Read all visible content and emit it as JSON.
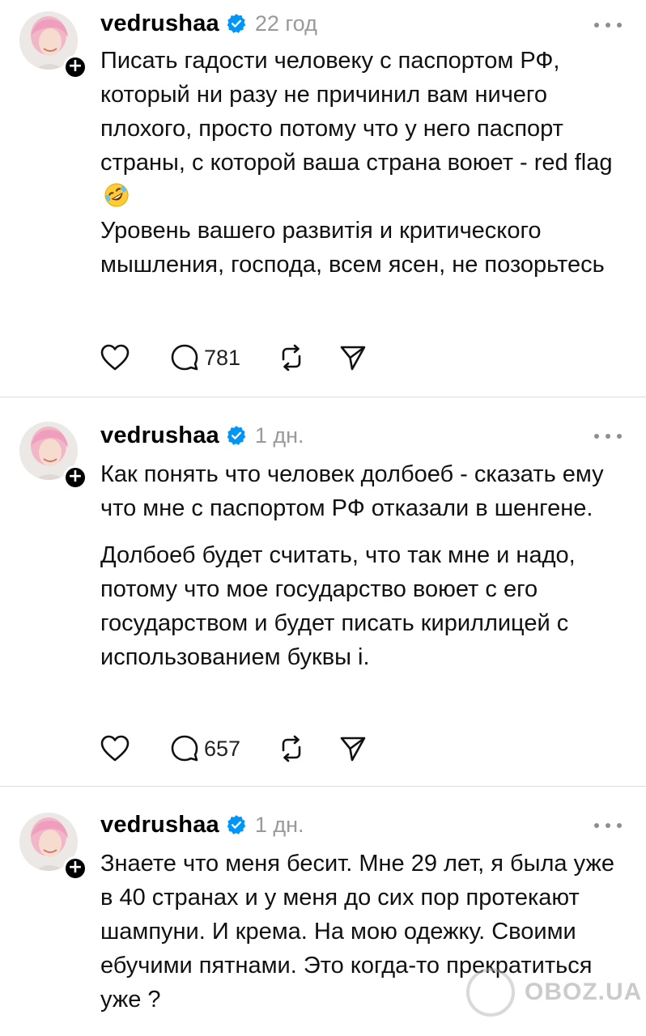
{
  "posts": [
    {
      "username": "vedrushaa",
      "time": "22 год",
      "paragraphs": [
        "Писать гадости человеку с паспортом РФ, который ни разу не причинил вам ничего плохого, просто потому что у него паспорт страны, с которой ваша страна воюет - red flag",
        "Уровень вашего развитія и критического мышления, господа, всем ясен, не позорьтесь"
      ],
      "emoji": "rolling-on-floor-laughing-emoji",
      "reply_count": "781"
    },
    {
      "username": "vedrushaa",
      "time": "1 дн.",
      "paragraphs": [
        "Как понять что человек долбоеб - сказать ему что мне с паспортом РФ отказали в шенгене.",
        "Долбоеб будет считать, что так мне и надо, потому что мое государство воюет с его государством и будет писать кириллицей с использованием буквы і."
      ],
      "reply_count": "657"
    },
    {
      "username": "vedrushaa",
      "time": "1 дн.",
      "paragraphs": [
        "Знаете что меня бесит. Мне 29 лет, я была уже в 40 странах и у меня до сих пор протекают шампуни. И крема. На мою одежку. Своими ебучими пятнами. Это когда-то прекратиться уже ?"
      ]
    }
  ],
  "watermark": {
    "text": "OBOZ.UA"
  },
  "colors": {
    "verified": "#0095f6",
    "muted": "#999999",
    "divider": "#dcdcdc"
  },
  "icons": [
    "heart-icon",
    "comment-icon",
    "repost-icon",
    "share-icon",
    "more-icon",
    "verified-badge-icon",
    "follow-plus-icon"
  ]
}
